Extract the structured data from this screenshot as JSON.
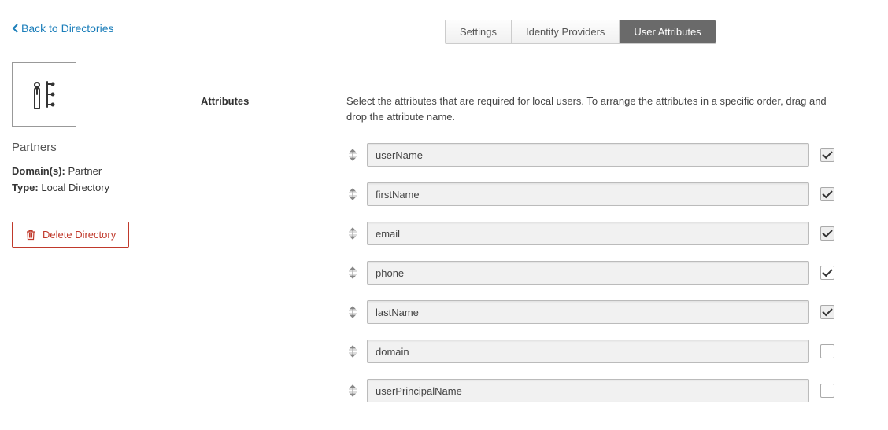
{
  "nav": {
    "back_label": "Back to Directories"
  },
  "tabs": {
    "settings": "Settings",
    "identity_providers": "Identity Providers",
    "user_attributes": "User Attributes"
  },
  "sidebar": {
    "directory_name": "Partners",
    "domains_label": "Domain(s):",
    "domains_value": "Partner",
    "type_label": "Type:",
    "type_value": "Local Directory",
    "delete_label": "Delete Directory"
  },
  "main": {
    "section_label": "Attributes",
    "help_text": "Select the attributes that are required for local users. To arrange the attributes in a specific order, drag and drop the attribute name.",
    "attributes": [
      {
        "name": "userName",
        "checked": true,
        "locked": true
      },
      {
        "name": "firstName",
        "checked": true,
        "locked": true
      },
      {
        "name": "email",
        "checked": true,
        "locked": true
      },
      {
        "name": "phone",
        "checked": true,
        "locked": false
      },
      {
        "name": "lastName",
        "checked": true,
        "locked": true
      },
      {
        "name": "domain",
        "checked": false,
        "locked": false
      },
      {
        "name": "userPrincipalName",
        "checked": false,
        "locked": false
      }
    ]
  }
}
